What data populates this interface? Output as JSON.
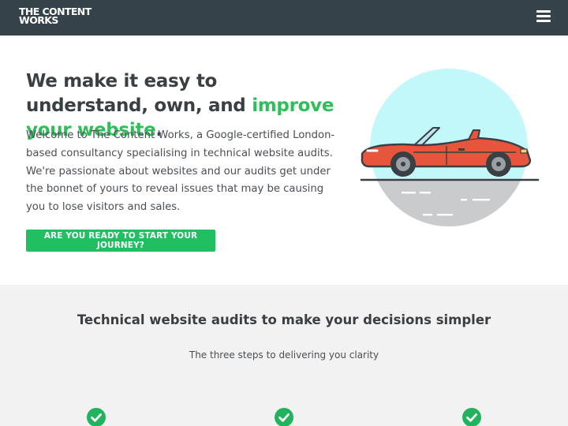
{
  "header": {
    "logo_line1": "THE CONTENT",
    "logo_line2": "WORKS",
    "menu_icon": "hamburger-menu-icon",
    "background": "#36424a"
  },
  "hero": {
    "title_before": "We make it easy to understand, own, and ",
    "title_accent": "improve your website",
    "title_after": ".",
    "body": "Welcome to The Content Works, a Google-certified London-based consultancy specialising in technical website audits. We're passionate about websites and our audits get under the bonnet of yours to reveal issues that may be causing you to lose visitors and sales.",
    "cta_label": "ARE YOU READY TO START YOUR JOURNEY?",
    "accent_color": "#2fbf5a",
    "illustration": "red-convertible-car-illustration"
  },
  "steps_section": {
    "title": "Technical website audits to make your decisions simpler",
    "subtitle": "The three steps to delivering you clarity",
    "step_icons": [
      "check-circle-icon",
      "check-circle-icon",
      "check-circle-icon"
    ],
    "background": "#f2f2f2"
  }
}
